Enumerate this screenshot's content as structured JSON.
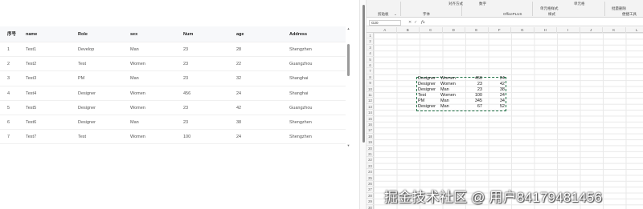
{
  "table": {
    "headers": [
      "序号",
      "name",
      "Role",
      "sex",
      "Num",
      "age",
      "Address"
    ],
    "rows": [
      [
        "1",
        "Test1",
        "Develop",
        "Man",
        "23",
        "28",
        "Shengzhen"
      ],
      [
        "2",
        "Test2",
        "Test",
        "Women",
        "23",
        "22",
        "Guangzhou"
      ],
      [
        "3",
        "Test3",
        "PM",
        "Man",
        "23",
        "32",
        "Shanghai"
      ],
      [
        "4",
        "Test4",
        "Designer",
        "Women",
        "456",
        "24",
        "Shanghai"
      ],
      [
        "5",
        "Test5",
        "Designer",
        "Women",
        "23",
        "42",
        "Guangzhou"
      ],
      [
        "6",
        "Test6",
        "Designer",
        "Man",
        "23",
        "38",
        "Shengzhen"
      ],
      [
        "7",
        "Test7",
        "Test",
        "Women",
        "100",
        "24",
        "Shengzhen"
      ]
    ],
    "scroll_up_icon": "▲",
    "scroll_down_icon": "▼"
  },
  "excel": {
    "ribbon": {
      "clipboard": "剪贴板",
      "font": "字体",
      "officeplus": "OfficePLUS",
      "style": "样式",
      "cell_style": "单元格样式",
      "quick_edit": "便捷工具",
      "batch_delete": "批量删除",
      "number": "数字",
      "align": "对齐方式",
      "cells": "单元格",
      "expand_icon": "⌄"
    },
    "namebox": "G20",
    "fx": "fx",
    "cancel_icon": "✕",
    "enter_icon": "✓",
    "columns": [
      "A",
      "B",
      "C",
      "D",
      "E",
      "F",
      "G",
      "H",
      "I",
      "J",
      "K",
      "L"
    ],
    "row_numbers": [
      "1",
      "2",
      "3",
      "4",
      "5",
      "6",
      "7",
      "8",
      "9",
      "10",
      "11",
      "12",
      "13",
      "14",
      "15",
      "16",
      "17",
      "18",
      "19",
      "20",
      "21",
      "22",
      "23",
      "24",
      "25",
      "26",
      "27",
      "28",
      "29",
      "30"
    ],
    "pasted_rows": [
      [
        "Designer",
        "Women",
        "456",
        "24"
      ],
      [
        "Designer",
        "Women",
        "23",
        "42"
      ],
      [
        "Designer",
        "Man",
        "23",
        "38"
      ],
      [
        "Test",
        "Women",
        "100",
        "24"
      ],
      [
        "PM",
        "Man",
        "345",
        "34"
      ],
      [
        "Designer",
        "Man",
        "67",
        "52"
      ]
    ]
  },
  "watermark": "掘金技术社区 @ 用户84179481456"
}
